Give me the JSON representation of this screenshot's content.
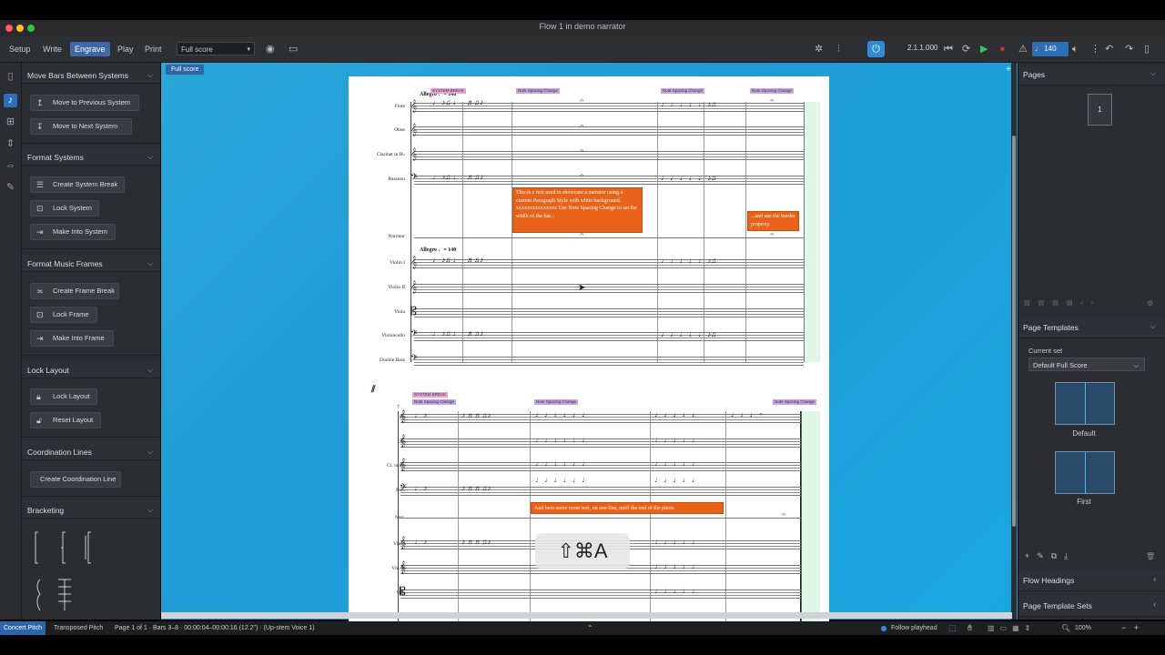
{
  "window": {
    "title": "Flow 1 in demo narrator"
  },
  "toolbar": {
    "modes": [
      "Setup",
      "Write",
      "Engrave",
      "Play",
      "Print"
    ],
    "layout_select": "Full score",
    "time_display": "2.1.1.000",
    "tempo": "140"
  },
  "tab": {
    "label": "Full score"
  },
  "left_panel": {
    "sections": [
      {
        "title": "Move Bars Between Systems",
        "buttons": [
          "Move to Previous System",
          "Move to Next System"
        ]
      },
      {
        "title": "Format Systems",
        "buttons": [
          "Create System Break",
          "Lock System",
          "Make Into System"
        ]
      },
      {
        "title": "Format Music Frames",
        "buttons": [
          "Create Frame Break",
          "Lock Frame",
          "Make Into Frame"
        ]
      },
      {
        "title": "Lock Layout",
        "buttons": [
          "Lock Layout",
          "Reset Layout"
        ]
      },
      {
        "title": "Coordination Lines",
        "buttons": [
          "Create Coordination Line"
        ]
      },
      {
        "title": "Bracketing",
        "buttons": []
      }
    ]
  },
  "score": {
    "system1": {
      "tempo_mark": "Allegro ♩= 140",
      "tempo_mark2": "Allegro ♩= 140",
      "instruments": [
        "Flute",
        "Oboe",
        "Clarinet in B♭",
        "Bassoon",
        "Narrator",
        "Violin I",
        "Violin II",
        "Viola",
        "Violoncello",
        "Double Bass"
      ],
      "signposts": [
        "SYSTEM BREAK",
        "Note Spacing Change",
        "Note Spacing Change",
        "Note Spacing Change"
      ],
      "text_box_1": "This is a text used to showcase a narrator using a custom Paragraph Style with white background. xxxxxxxxxxxxxxx Use Note Spacing Change to set the width of the bar...",
      "text_box_2": "...and use the border property."
    },
    "system2": {
      "bar_number": "7",
      "instruments": [
        "Fl.",
        "Ob.",
        "Cl. in B♭",
        "Bsn.",
        "Narr.",
        "Vln. I",
        "Vln. II",
        "Vla."
      ],
      "signposts": [
        "SYSTEM BREAK",
        "Note Spacing Change",
        "Note Spacing Change",
        "Note Spacing Change"
      ],
      "text_box": "And here some more text, on one line, until the end of the piece."
    }
  },
  "right_panel": {
    "pages_title": "Pages",
    "page_number": "1",
    "templates_title": "Page Templates",
    "current_set_label": "Current set",
    "current_set_value": "Default Full Score",
    "templates": [
      "Default",
      "First"
    ],
    "flow_headings": "Flow Headings",
    "template_sets": "Page Template Sets"
  },
  "status_bar": {
    "concert_pitch": "Concert Pitch",
    "transposed_pitch": "Transposed Pitch",
    "info": "Page 1 of 1 · Bars 3–8 · 00:00:04–00:00:16 (12.2\") · (Up-stem Voice 1)",
    "follow_playhead": "Follow playhead",
    "zoom": "100%"
  },
  "overlay": {
    "shortcut": "⇧⌘A"
  }
}
